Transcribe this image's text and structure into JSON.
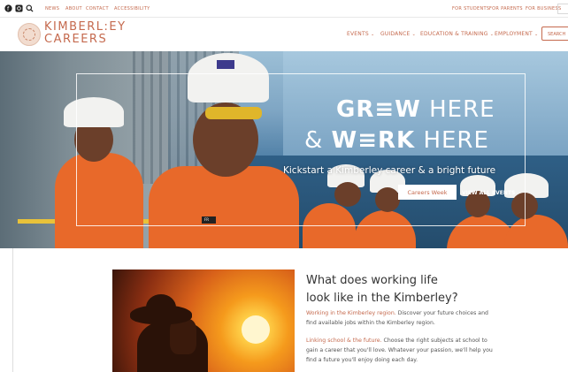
{
  "topbar": {
    "left_links": [
      "NEWS",
      "ABOUT",
      "CONTACT",
      "ACCESSIBILITY"
    ],
    "right_links": [
      "FOR STUDENTS",
      "FOR PARENTS",
      "FOR BUSINESS"
    ]
  },
  "brand": {
    "line1": "KIMBERL:EY",
    "line2": "CAREERS",
    "color": "#c56a4e"
  },
  "nav": {
    "items": [
      "EVENTS",
      "GUIDANCE",
      "EDUCATION & TRAINING",
      "EMPLOYMENT"
    ],
    "chevron": "⌄",
    "search_label": "SEARCH"
  },
  "hero": {
    "line1_bold": "GR≡W",
    "line1_rest": " HERE",
    "line2_pre": "& ",
    "line2_bold": "W≡RK",
    "line2_rest": " HERE",
    "subtitle": "Kickstart a Kimberley career & a bright future",
    "button_primary": "Careers Week",
    "button_secondary": "VIEW ALL EVENTS",
    "badge": "FR"
  },
  "content": {
    "title_line1": "What does working life",
    "title_line2": "look like in the Kimberley?",
    "para1_lead": "Working in the Kimberley region.",
    "para1_body": " Discover your future choices and find available jobs within the Kimberley region.",
    "para2_lead": "Linking school & the future.",
    "para2_body": " Choose the right subjects at school to gain a career that you'll love. Whatever your passion, we'll help you find a future you'll enjoy doing each day."
  }
}
